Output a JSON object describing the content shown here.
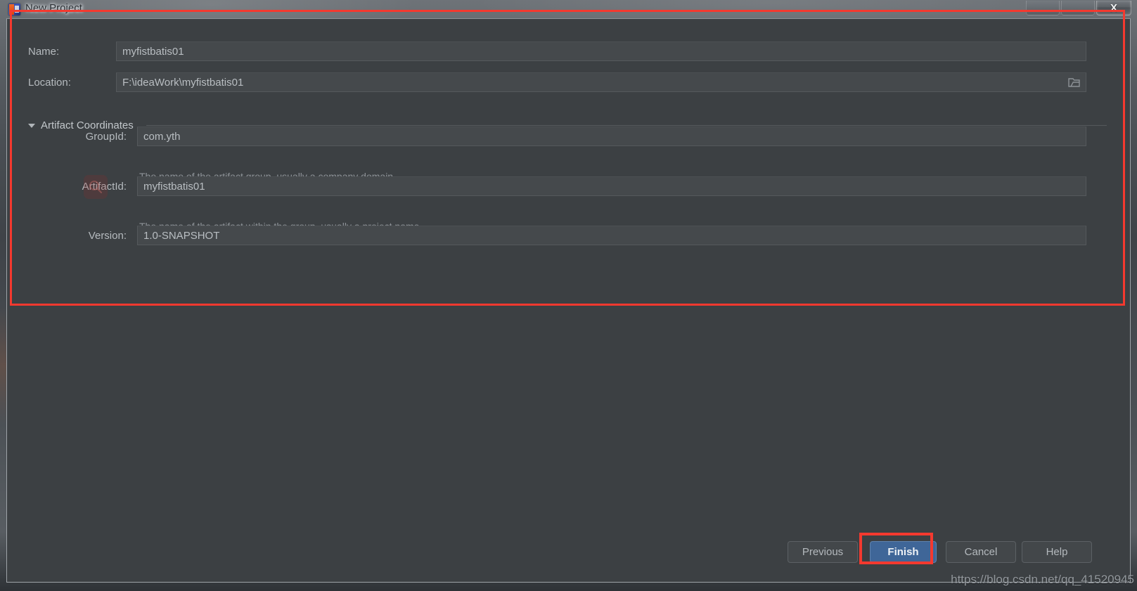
{
  "window": {
    "title": "New Project",
    "app_icon": "intellij-idea-icon",
    "close_label": "X"
  },
  "form": {
    "name": {
      "label": "Name:",
      "value": "myfistbatis01"
    },
    "location": {
      "label": "Location:",
      "value": "F:\\ideaWork\\myfistbatis01",
      "browse_icon": "folder-icon"
    },
    "artifact_section": {
      "label": "Artifact Coordinates",
      "expanded": true,
      "arrow_icon": "chevron-down-icon"
    },
    "group_id": {
      "label": "GroupId:",
      "value": "com.yth",
      "hint": "The name of the artifact group, usually a company domain"
    },
    "artifact_id": {
      "label": "ArtifactId:",
      "value": "myfistbatis01",
      "hint": "The name of the artifact within the group, usually a project name"
    },
    "version": {
      "label": "Version:",
      "value": "1.0-SNAPSHOT"
    }
  },
  "footer": {
    "previous_label": "Previous",
    "finish_label": "Finish",
    "cancel_label": "Cancel",
    "help_label": "Help"
  },
  "annotations": {
    "color": "#f4392f",
    "form_box": "highlight-form-region",
    "finish_box": "highlight-finish-button"
  },
  "watermark": {
    "text": "https://blog.csdn.net/qq_41520945",
    "search_icon": "search-icon"
  },
  "theme": {
    "background": "#3c4043",
    "field_background": "#45494c",
    "accent_blue": "#3f6698",
    "text": "#b6bbbf",
    "hint_text": "#8e9398"
  }
}
